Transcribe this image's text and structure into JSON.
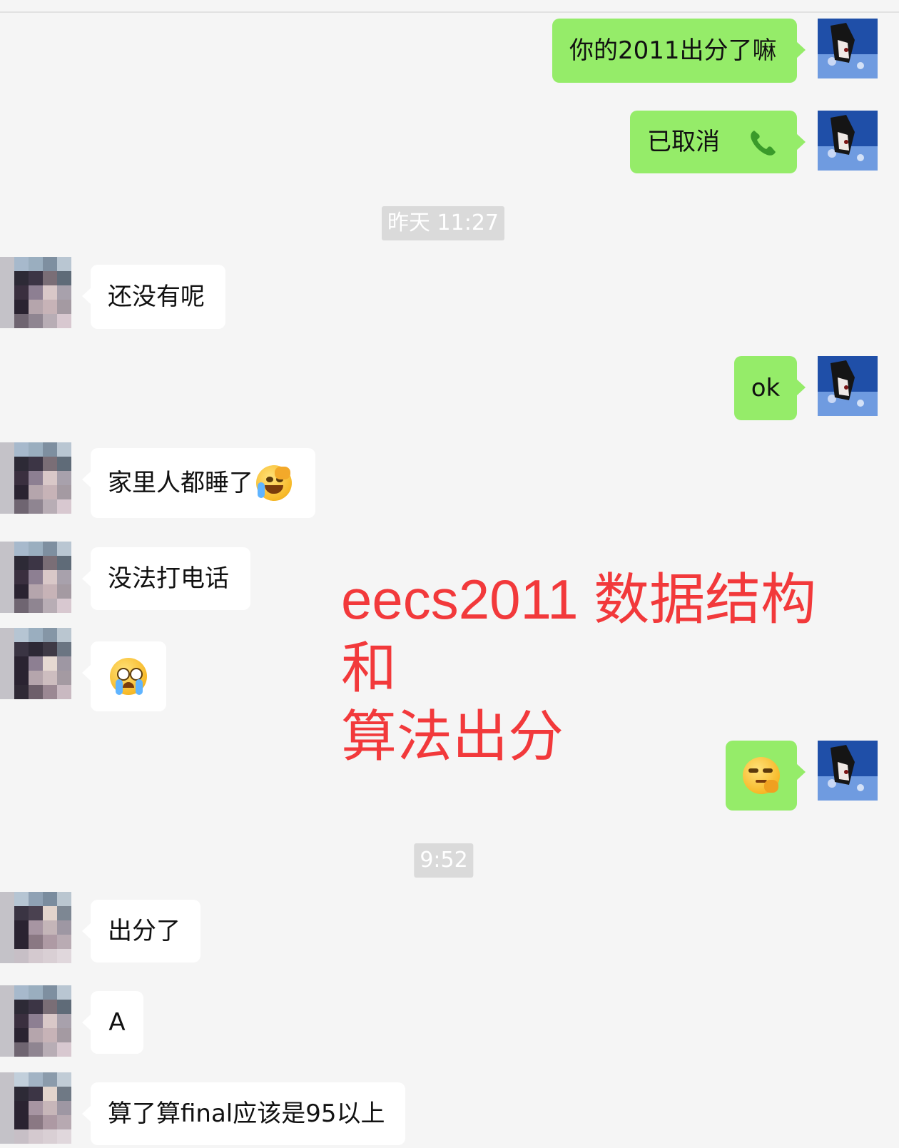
{
  "messages": {
    "m1": "你的2011出分了嘛",
    "m2": "已取消",
    "ts1": "昨天 11:27",
    "m3": "还没有呢",
    "m4": "ok",
    "m5": "家里人都睡了",
    "m6": "没法打电话",
    "ts2": "9:52",
    "m7": "出分了",
    "m8": "A",
    "m9": "算了算final应该是95以上"
  },
  "overlay": {
    "line1": "eecs2011 数据结构和",
    "line2": "算法出分"
  },
  "icons": {
    "call": "phone-icon",
    "emoji_facepalm": "facepalm-laugh-emoji",
    "emoji_crying": "crying-emoji",
    "emoji_smirk": "smirk-ok-emoji"
  },
  "colors": {
    "self_bubble": "#95ec69",
    "other_bubble": "#ffffff",
    "background": "#f5f5f5",
    "overlay_text": "#f2393b",
    "timestamp_bg": "#dadada"
  }
}
